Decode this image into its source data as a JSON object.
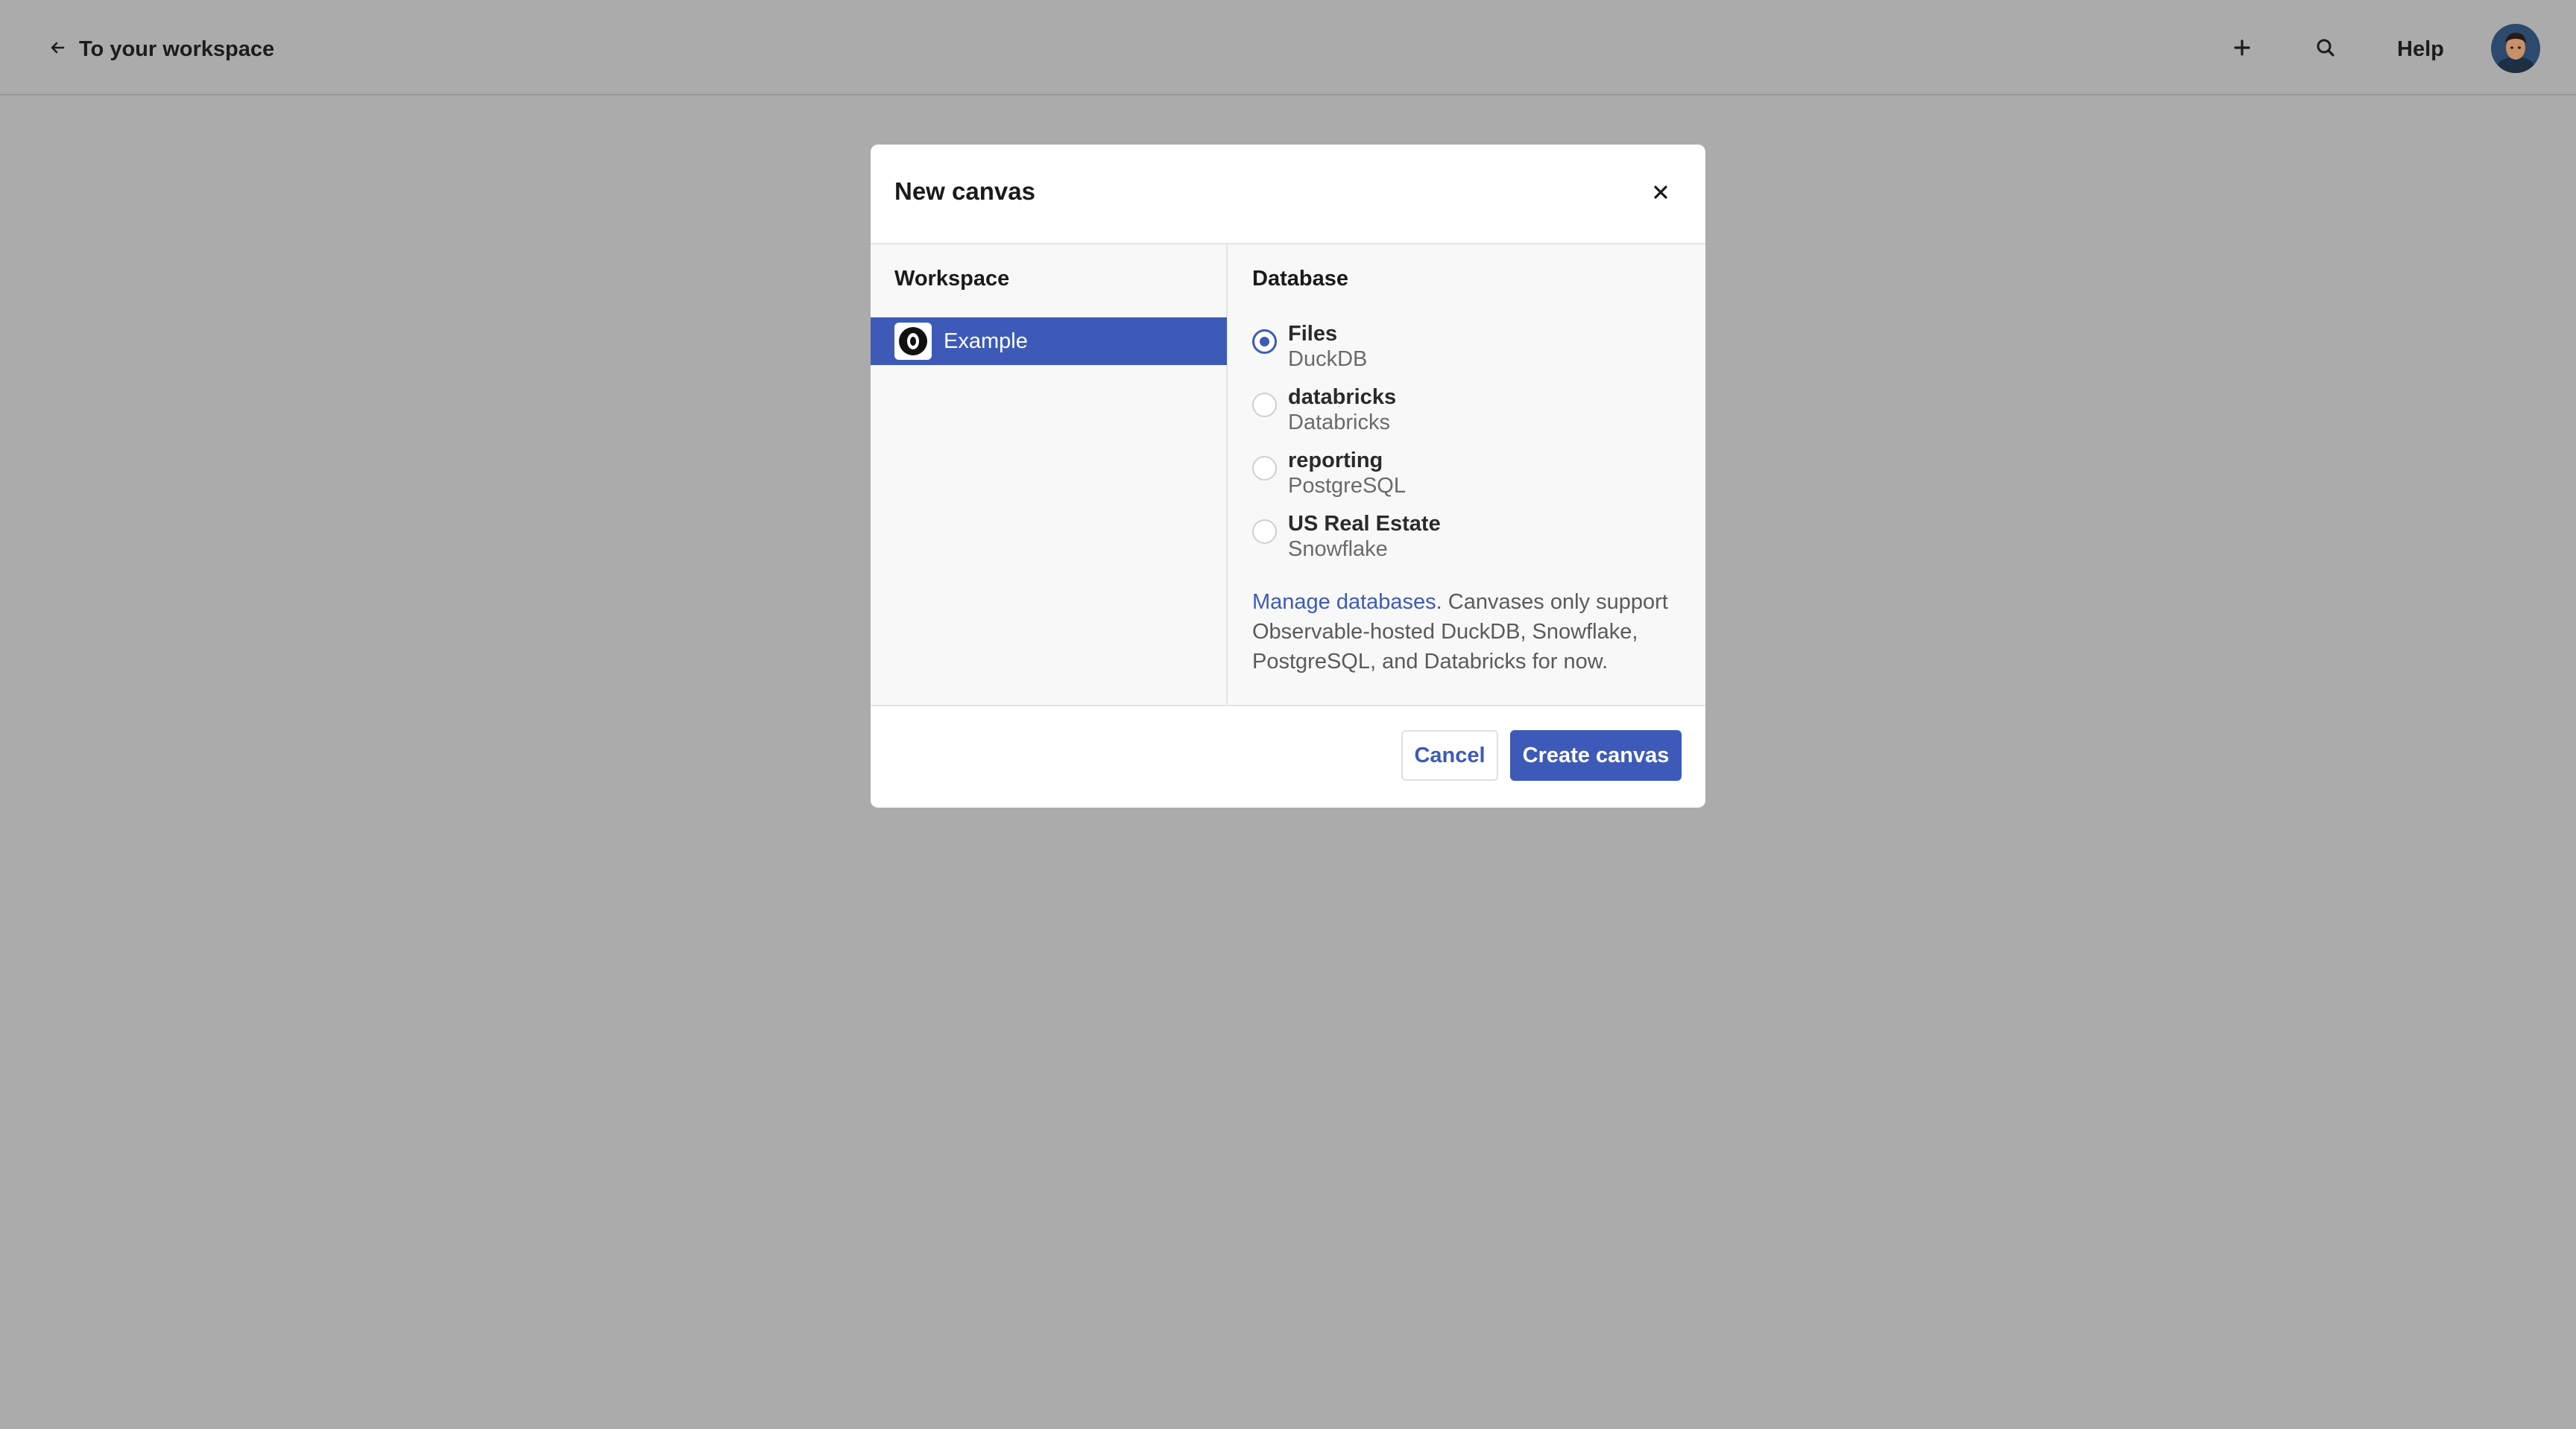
{
  "topbar": {
    "back_label": "To your workspace",
    "back_icon": "arrow-left-icon",
    "add_icon": "plus-icon",
    "search_icon": "search-icon",
    "help_label": "Help",
    "avatar_icon": "user-avatar"
  },
  "modal": {
    "title": "New canvas",
    "close_icon": "close-icon",
    "workspace_heading": "Workspace",
    "workspaces": [
      {
        "label": "Example",
        "selected": true,
        "icon": "observable-logo-icon"
      }
    ],
    "database_heading": "Database",
    "databases": [
      {
        "name": "Files",
        "type": "DuckDB",
        "selected": true
      },
      {
        "name": "databricks",
        "type": "Databricks",
        "selected": false
      },
      {
        "name": "reporting",
        "type": "PostgreSQL",
        "selected": false
      },
      {
        "name": "US Real Estate",
        "type": "Snowflake",
        "selected": false
      }
    ],
    "manage_link": "Manage databases.",
    "help_text": " Canvases only support Observable-hosted DuckDB, Snowflake, PostgreSQL, and Databricks for now.",
    "cancel_label": "Cancel",
    "create_label": "Create canvas"
  },
  "colors": {
    "accent": "#3d5ab8",
    "backdrop": "#ababab",
    "modal_bg": "#ffffff",
    "panel_bg": "#f8f8f8"
  }
}
